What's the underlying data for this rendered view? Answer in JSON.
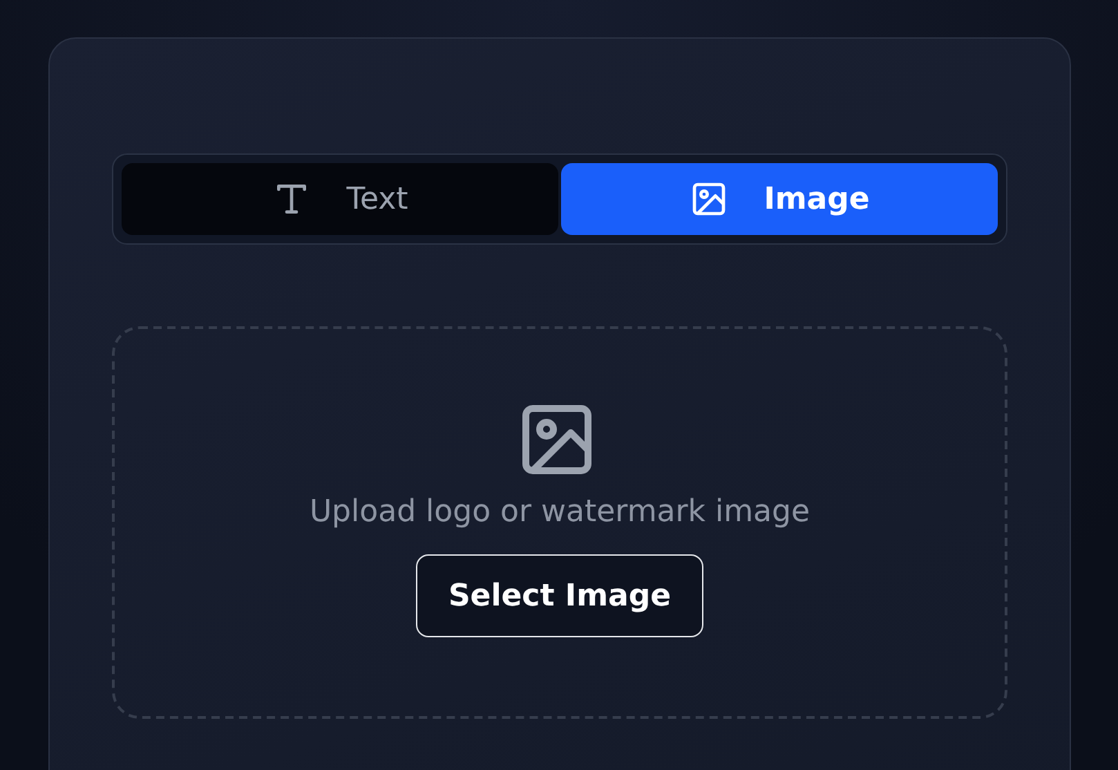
{
  "tabs": [
    {
      "kind": "text",
      "label": "Text",
      "selected": false
    },
    {
      "kind": "image",
      "label": "Image",
      "selected": true
    }
  ],
  "upload": {
    "prompt": "Upload logo or watermark image",
    "button": "Select Image"
  }
}
